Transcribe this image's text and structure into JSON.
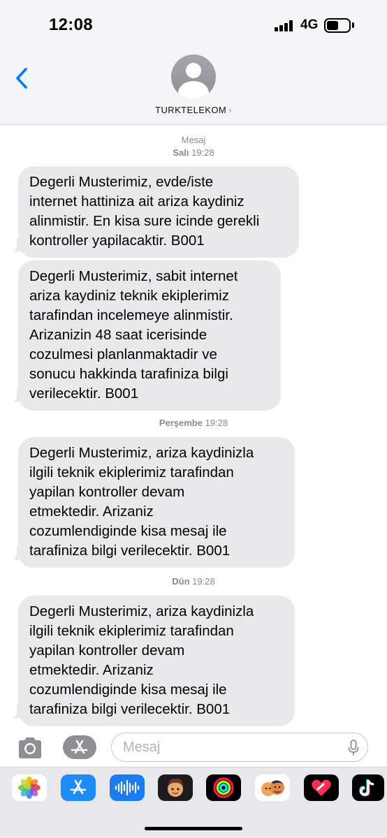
{
  "status_bar": {
    "time": "12:08",
    "network": "4G"
  },
  "header": {
    "contact_name": "TURKTELEKOM"
  },
  "thread": {
    "timestamps": [
      {
        "label": "Mesaj",
        "day": "Salı",
        "time": "19:28"
      },
      {
        "day": "Perşembe",
        "time": "19:28"
      },
      {
        "day": "Dün",
        "time": "19:28"
      }
    ],
    "messages": [
      {
        "text": "Degerli Musterimiz, evde/iste\ninternet hattiniza ait ariza kaydiniz\nalinmistir. En kisa sure icinde gerekli\nkontroller yapilacaktir. B001"
      },
      {
        "text": "Degerli Musterimiz, sabit internet\nariza kaydiniz teknik ekiplerimiz\ntarafindan incelemeye alinmistir.\nArizanizin 48 saat icerisinde\ncozulmesi planlanmaktadir ve\nsonucu hakkinda tarafiniza bilgi\nverilecektir. B001"
      },
      {
        "text": "Degerli Musterimiz, ariza kaydinizla\nilgili teknik ekiplerimiz tarafindan\nyapilan kontroller devam\netmektedir. Arizaniz\ncozumlendiginde kisa mesaj ile\ntarafiniza bilgi verilecektir. B001"
      },
      {
        "text": "Degerli Musterimiz, ariza kaydinizla\nilgili teknik ekiplerimiz tarafindan\nyapilan kontroller devam\netmektedir. Arizaniz\ncozumlendiginde kisa mesaj ile\ntarafiniza bilgi verilecektir. B001"
      }
    ]
  },
  "composer": {
    "placeholder": "Mesaj"
  },
  "app_drawer": {
    "apps": [
      {
        "icon": "photos-icon"
      },
      {
        "icon": "app-store-icon"
      },
      {
        "icon": "audio-message-icon"
      },
      {
        "icon": "memoji-icon"
      },
      {
        "icon": "fitness-activity-icon"
      },
      {
        "icon": "memoji-stickers-icon"
      },
      {
        "icon": "digital-touch-icon"
      },
      {
        "icon": "tiktok-icon"
      }
    ]
  },
  "colors": {
    "accent": "#007aff",
    "bubble_incoming": "#e9e9eb",
    "header_background": "#f5f5f7",
    "timestamp_text": "#8a8a8e"
  }
}
